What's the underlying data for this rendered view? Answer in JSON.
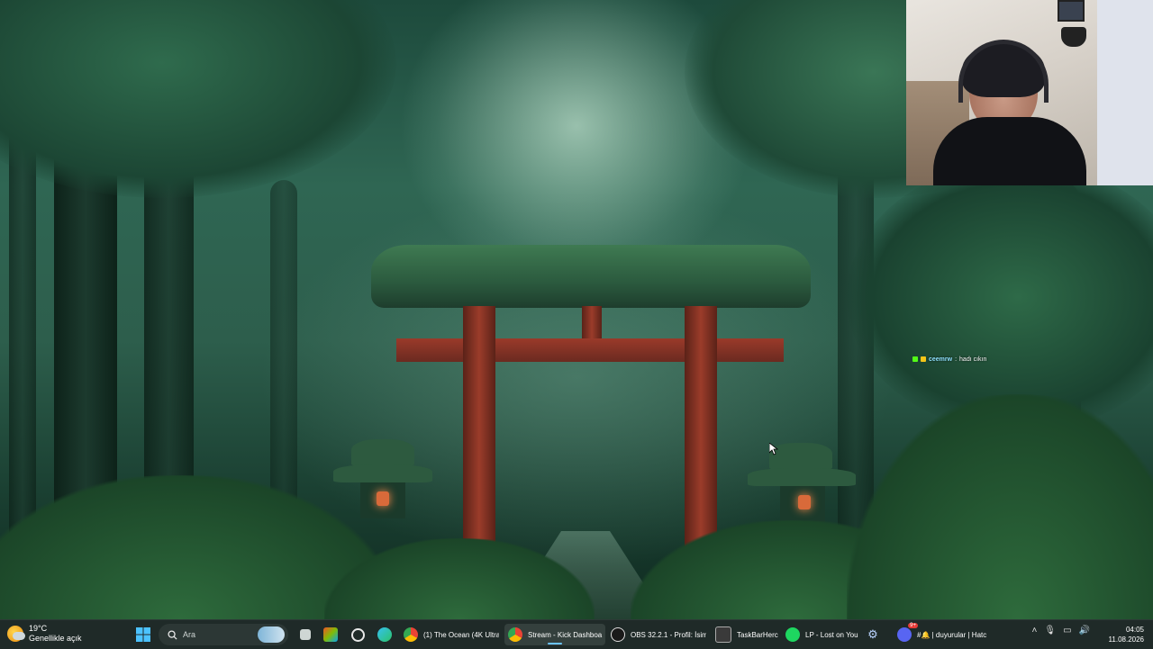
{
  "wallpaper": {
    "description_free": true
  },
  "chat_overlay": {
    "username": "ceemrw",
    "separator": ":",
    "message": "hadı cıkın"
  },
  "taskbar": {
    "weather": {
      "temperature": "19°C",
      "condition": "Genellikle açık"
    },
    "search": {
      "placeholder": "Ara"
    },
    "apps": [
      {
        "id": "chrome-ocean",
        "label": "(1) The Ocean (4K Ultra"
      },
      {
        "id": "chrome-kick",
        "label": "Stream - Kick Dashboa"
      },
      {
        "id": "obs",
        "label": "OBS 32.2.1 - Profil: İsim"
      },
      {
        "id": "taskbarhero",
        "label": "TaskBarHerc"
      },
      {
        "id": "spotify",
        "label": "LP - Lost on You"
      },
      {
        "id": "discord",
        "label": "#🔔 | duyurular | Hatc"
      }
    ],
    "discord_badge": "9+",
    "clock": {
      "time": "04:05",
      "date": "11.08.2026"
    }
  },
  "colors": {
    "taskbar_bg": "#1f2a28",
    "active_indicator": "#6cc4ff",
    "kick_green": "#53fc18"
  }
}
